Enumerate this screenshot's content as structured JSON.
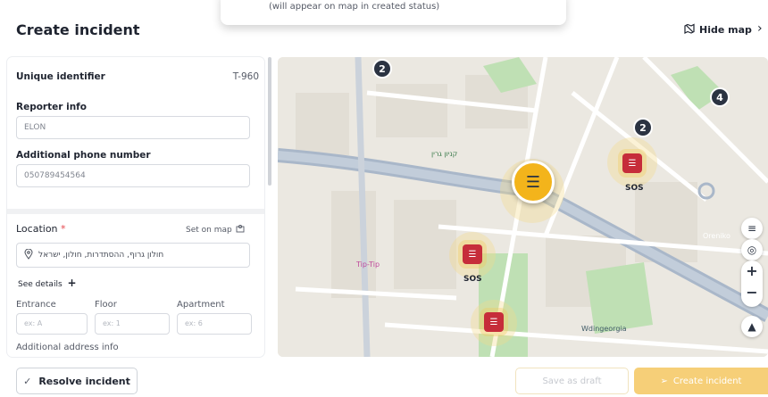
{
  "header": {
    "title": "Create incident",
    "hide_map_label": "Hide map",
    "toast_text": "(will appear on map in created status)"
  },
  "form": {
    "unique_identifier_label": "Unique identifier",
    "unique_identifier_value": "T-960",
    "reporter_label": "Reporter info",
    "reporter_value": "ELON",
    "phone_label": "Additional phone number",
    "phone_value": "050789454564",
    "location_label": "Location",
    "location_required": "*",
    "set_on_map_label": "Set on map",
    "location_value": "חולון גרוף, ההסתדרות, חולון, ישראל",
    "see_details_label": "See details",
    "entrance_label": "Entrance",
    "entrance_placeholder": "ex: A",
    "floor_label": "Floor",
    "floor_placeholder": "ex: 1",
    "apartment_label": "Apartment",
    "apartment_placeholder": "ex: 6",
    "additional_address_label": "Additional address info"
  },
  "map": {
    "sos_label": "SOS",
    "cluster_counts": [
      "2",
      "2",
      "4"
    ],
    "place_labels": [
      "Tip-Tip",
      "Oreniko",
      "Wdingeorgia",
      "קניון גרין"
    ],
    "zoom_in": "+",
    "zoom_out": "−"
  },
  "footer": {
    "resolve_label": "Resolve incident",
    "draft_label": "Save as draft",
    "create_label": "Create incident"
  },
  "colors": {
    "accent": "#f3b41b",
    "incident_red": "#c62d3a",
    "cluster_dark": "#2b3342"
  }
}
